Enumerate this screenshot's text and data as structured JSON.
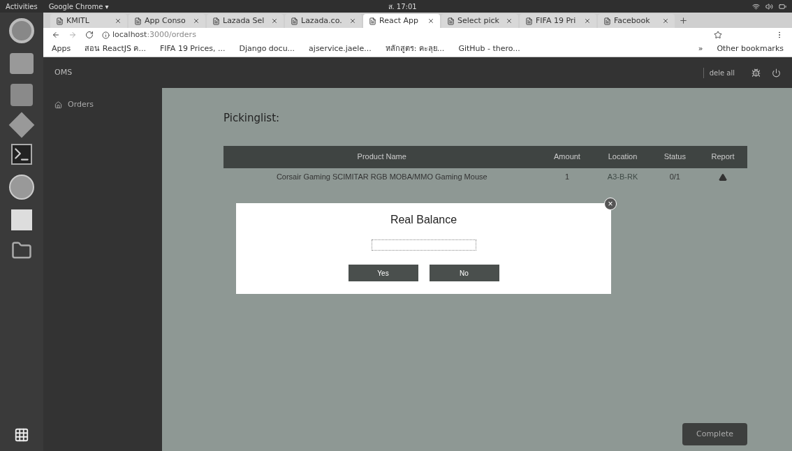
{
  "topbar": {
    "activities": "Activities",
    "app_menu": "Google Chrome ▾",
    "clock": "ส. 17:01"
  },
  "tabs": [
    {
      "label": "KMITL",
      "selected": false
    },
    {
      "label": "App Conso",
      "selected": false
    },
    {
      "label": "Lazada Sel",
      "selected": false
    },
    {
      "label": "Lazada.co.",
      "selected": false
    },
    {
      "label": "React App",
      "selected": true
    },
    {
      "label": "Select pick",
      "selected": false
    },
    {
      "label": "FIFA 19 Pri",
      "selected": false
    },
    {
      "label": "Facebook",
      "selected": false
    }
  ],
  "address": {
    "host": "localhost",
    "path": ":3000/orders"
  },
  "bookmarks": [
    "Apps",
    "สอน ReactJS ค...",
    "FIFA 19 Prices, ...",
    "Django docu...",
    "ajservice.jaele...",
    "หลักสูตร: คะลุย...",
    "GitHub - thero..."
  ],
  "bookmarks_more": "»",
  "other_bookmarks": "Other bookmarks",
  "app": {
    "brand": "OMS",
    "delete_all": "dele all",
    "nav": [
      {
        "label": "Orders",
        "selected": true
      }
    ],
    "title": "Pickinglist:",
    "table": {
      "columns": [
        "Product Name",
        "Amount",
        "Location",
        "Status",
        "Report"
      ],
      "rows": [
        {
          "product": "Corsair Gaming SCIMITAR RGB MOBA/MMO Gaming Mouse",
          "amount": "1",
          "location": "A3-B-RK",
          "status": "0/1"
        }
      ]
    },
    "complete": "Complete"
  },
  "dialog": {
    "title": "Real Balance",
    "buttons": [
      "Yes",
      "No"
    ],
    "close": "×"
  }
}
